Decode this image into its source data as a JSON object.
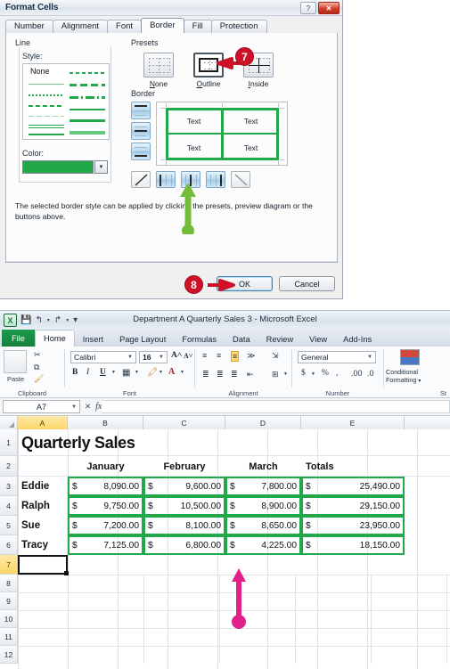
{
  "dialog": {
    "title": "Format Cells",
    "window_buttons": [
      {
        "name": "help-button",
        "glyph": "?"
      },
      {
        "name": "close-button",
        "glyph": "✕"
      }
    ],
    "tabs": [
      {
        "label": "Number",
        "active": false
      },
      {
        "label": "Alignment",
        "active": false
      },
      {
        "label": "Font",
        "active": false
      },
      {
        "label": "Border",
        "active": true
      },
      {
        "label": "Fill",
        "active": false
      },
      {
        "label": "Protection",
        "active": false
      }
    ],
    "line_group_label": "Line",
    "style_label": "Style:",
    "style_none_label": "None",
    "color_label": "Color:",
    "color_value": "#22a84a",
    "presets_label": "Presets",
    "presets": [
      {
        "label": "None",
        "underline": "N",
        "selected": false
      },
      {
        "label": "Outline",
        "underline": "O",
        "selected": true
      },
      {
        "label": "Inside",
        "underline": "I",
        "selected": false
      }
    ],
    "border_group_label": "Border",
    "preview_cells": [
      "Text",
      "Text",
      "Text",
      "Text"
    ],
    "help_text": "The selected border style can be applied by clicking the presets, preview diagram or the buttons above.",
    "ok_label": "OK",
    "cancel_label": "Cancel",
    "callouts": [
      {
        "number": "7",
        "target": "outline-preset"
      },
      {
        "number": "8",
        "target": "ok-button"
      }
    ]
  },
  "excel": {
    "title": "Department A Quarterly Sales 3  -  Microsoft Excel",
    "quick_access": [
      "save-icon",
      "undo-icon",
      "redo-icon",
      "customize-icon"
    ],
    "ribbon_tabs": [
      {
        "label": "File",
        "active": false,
        "kind": "file"
      },
      {
        "label": "Home",
        "active": true,
        "kind": "normal"
      },
      {
        "label": "Insert",
        "active": false,
        "kind": "normal"
      },
      {
        "label": "Page Layout",
        "active": false,
        "kind": "normal"
      },
      {
        "label": "Formulas",
        "active": false,
        "kind": "normal"
      },
      {
        "label": "Data",
        "active": false,
        "kind": "normal"
      },
      {
        "label": "Review",
        "active": false,
        "kind": "normal"
      },
      {
        "label": "View",
        "active": false,
        "kind": "normal"
      },
      {
        "label": "Add-Ins",
        "active": false,
        "kind": "normal"
      }
    ],
    "ribbon_groups": {
      "clipboard": {
        "label": "Clipboard",
        "paste_label": "Paste"
      },
      "font": {
        "label": "Font",
        "font_name": "Calibri",
        "font_size": "16",
        "bold": "B",
        "italic": "I",
        "underline": "U"
      },
      "alignment": {
        "label": "Alignment"
      },
      "number": {
        "label": "Number",
        "format": "General",
        "currency": "$",
        "percent": "%",
        "comma": ","
      },
      "styles": {
        "label": "St",
        "conditional_formatting": "Conditional\nFormatting"
      }
    },
    "name_box": "A7",
    "formula_bar_value": "",
    "columns": [
      "A",
      "B",
      "C",
      "D",
      "E"
    ],
    "selected_column": "A",
    "rows": [
      "1",
      "2",
      "3",
      "4",
      "5",
      "6",
      "7",
      "8",
      "9",
      "10",
      "11",
      "12"
    ],
    "selected_row": "7",
    "selected_cell": "A7",
    "sheet_title": "Quarterly Sales",
    "headers": [
      "",
      "January",
      "February",
      "March",
      "Totals"
    ],
    "data_rows": [
      {
        "name": "Eddie",
        "january": "8,090.00",
        "february": "9,600.00",
        "march": "7,800.00",
        "totals": "25,490.00"
      },
      {
        "name": "Ralph",
        "january": "9,750.00",
        "february": "10,500.00",
        "march": "8,900.00",
        "totals": "29,150.00"
      },
      {
        "name": "Sue",
        "january": "7,200.00",
        "february": "8,100.00",
        "march": "8,650.00",
        "totals": "23,950.00"
      },
      {
        "name": "Tracy",
        "january": "7,125.00",
        "february": "6,800.00",
        "march": "4,225.00",
        "totals": "18,150.00"
      }
    ],
    "currency_symbol": "$",
    "border_color": "#22a84a",
    "annotation_arrow_color": "#e0218a"
  }
}
